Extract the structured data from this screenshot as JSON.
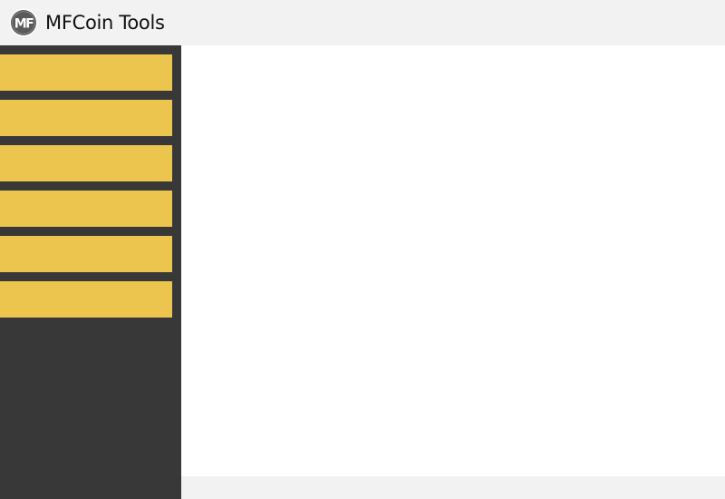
{
  "app": {
    "title": "MFCoin Tools",
    "logo_icon": "mfcoin-logo-icon",
    "logo_text": "MF"
  },
  "colors": {
    "titlebar_bg": "#f2f2f2",
    "sidebar_bg": "#383838",
    "menu_button": "#ecc54f",
    "main_bg": "#ffffff",
    "statusbar_bg": "#f2f2f2",
    "logo_fill": "#5a5a5a"
  },
  "sidebar": {
    "items": [
      {
        "label": ""
      },
      {
        "label": ""
      },
      {
        "label": ""
      },
      {
        "label": ""
      },
      {
        "label": ""
      },
      {
        "label": ""
      }
    ]
  },
  "statusbar": {
    "text": ""
  }
}
